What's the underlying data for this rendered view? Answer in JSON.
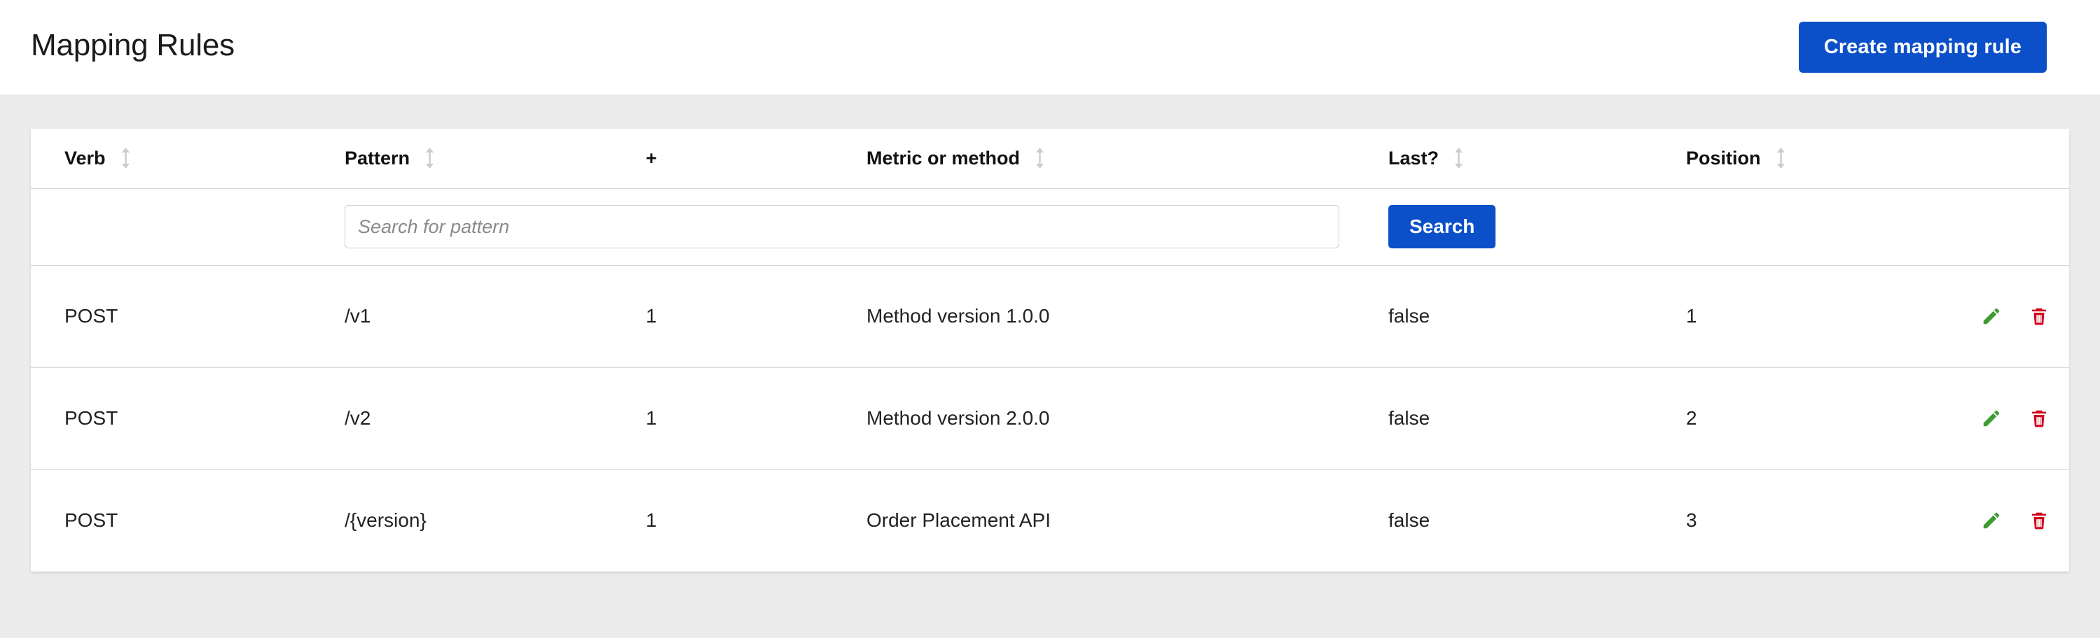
{
  "header": {
    "title": "Mapping Rules",
    "create_button_label": "Create mapping rule",
    "accent_color": "#0b50c8"
  },
  "table": {
    "columns": [
      {
        "key": "verb",
        "label": "Verb",
        "sortable": true
      },
      {
        "key": "pattern",
        "label": "Pattern",
        "sortable": true
      },
      {
        "key": "plus",
        "label": "+",
        "sortable": false
      },
      {
        "key": "metric",
        "label": "Metric or method",
        "sortable": true
      },
      {
        "key": "last",
        "label": "Last?",
        "sortable": true
      },
      {
        "key": "position",
        "label": "Position",
        "sortable": true
      }
    ],
    "search": {
      "placeholder": "Search for pattern",
      "value": "",
      "button_label": "Search"
    },
    "rows": [
      {
        "verb": "POST",
        "pattern": "/v1",
        "plus": "1",
        "metric": "Method version 1.0.0",
        "last": "false",
        "position": "1",
        "edit_icon": "pencil-icon",
        "delete_icon": "trash-icon"
      },
      {
        "verb": "POST",
        "pattern": "/v2",
        "plus": "1",
        "metric": "Method version 2.0.0",
        "last": "false",
        "position": "2",
        "edit_icon": "pencil-icon",
        "delete_icon": "trash-icon"
      },
      {
        "verb": "POST",
        "pattern": "/{version}",
        "plus": "1",
        "metric": "Order Placement API",
        "last": "false",
        "position": "3",
        "edit_icon": "pencil-icon",
        "delete_icon": "trash-icon"
      }
    ],
    "icon_colors": {
      "edit": "#3f9c35",
      "delete": "#d0021b",
      "sort": "#cccccc"
    }
  }
}
